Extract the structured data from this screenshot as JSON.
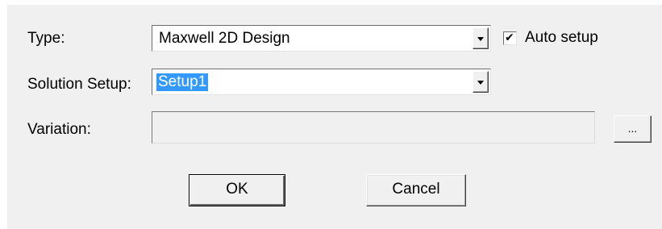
{
  "form": {
    "type_label": "Type:",
    "type_value": "Maxwell 2D Design",
    "auto_setup_label": "Auto setup",
    "auto_setup_checked": true,
    "solution_setup_label": "Solution Setup:",
    "solution_setup_value": "Setup1",
    "variation_label": "Variation:",
    "variation_value": "",
    "browse_label": "...",
    "ok_label": "OK",
    "cancel_label": "Cancel"
  },
  "icons": {
    "dropdown": "chevron-down-icon",
    "checkbox": "checkmark-icon"
  },
  "colors": {
    "dialog_bg": "#f0f0f0",
    "selection": "#3399ff"
  }
}
